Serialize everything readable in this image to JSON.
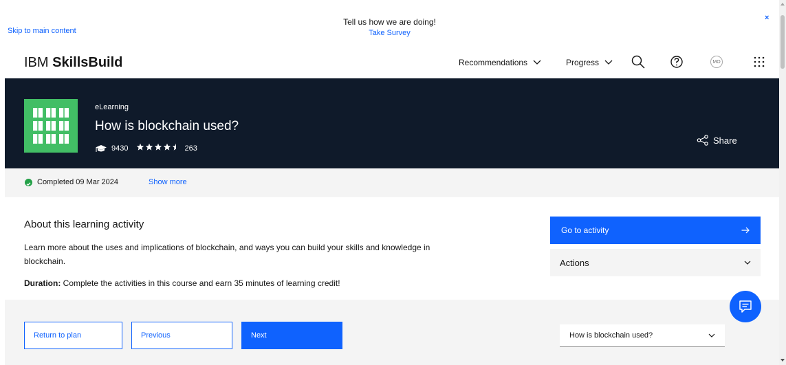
{
  "survey": {
    "skip_link": "Skip to main content",
    "message": "Tell us how we are doing!",
    "link": "Take Survey",
    "close_glyph": "×"
  },
  "header": {
    "brand_prefix": "IBM",
    "brand_name": "SkillsBuild",
    "nav": [
      {
        "label": "Recommendations"
      },
      {
        "label": "Progress"
      }
    ],
    "avatar_initials": "MO",
    "icons": [
      "search-icon",
      "help-icon",
      "avatar",
      "app-switcher-icon"
    ]
  },
  "hero": {
    "type": "eLearning",
    "title": "How is blockchain used?",
    "learners": "9430",
    "rating": 4.5,
    "rating_count": "263",
    "share_label": "Share",
    "thumbnail_color": "#42be65",
    "background": "#0f1a2a"
  },
  "status": {
    "completed": "Completed 09 Mar 2024",
    "show_more": "Show more"
  },
  "about": {
    "heading": "About this learning activity",
    "description": "Learn more about the uses and implications of blockchain, and ways you can build your skills and knowledge in blockchain.",
    "duration_label": "Duration:",
    "duration_text": " Complete the activities in this course and earn 35 minutes of learning credit!"
  },
  "sidebar": {
    "go_label": "Go to activity",
    "actions_label": "Actions"
  },
  "footer": {
    "return_label": "Return to plan",
    "previous_label": "Previous",
    "next_label": "Next",
    "selected_activity": "How is blockchain used?"
  },
  "colors": {
    "accent": "#0f62fe",
    "success": "#24a148"
  }
}
